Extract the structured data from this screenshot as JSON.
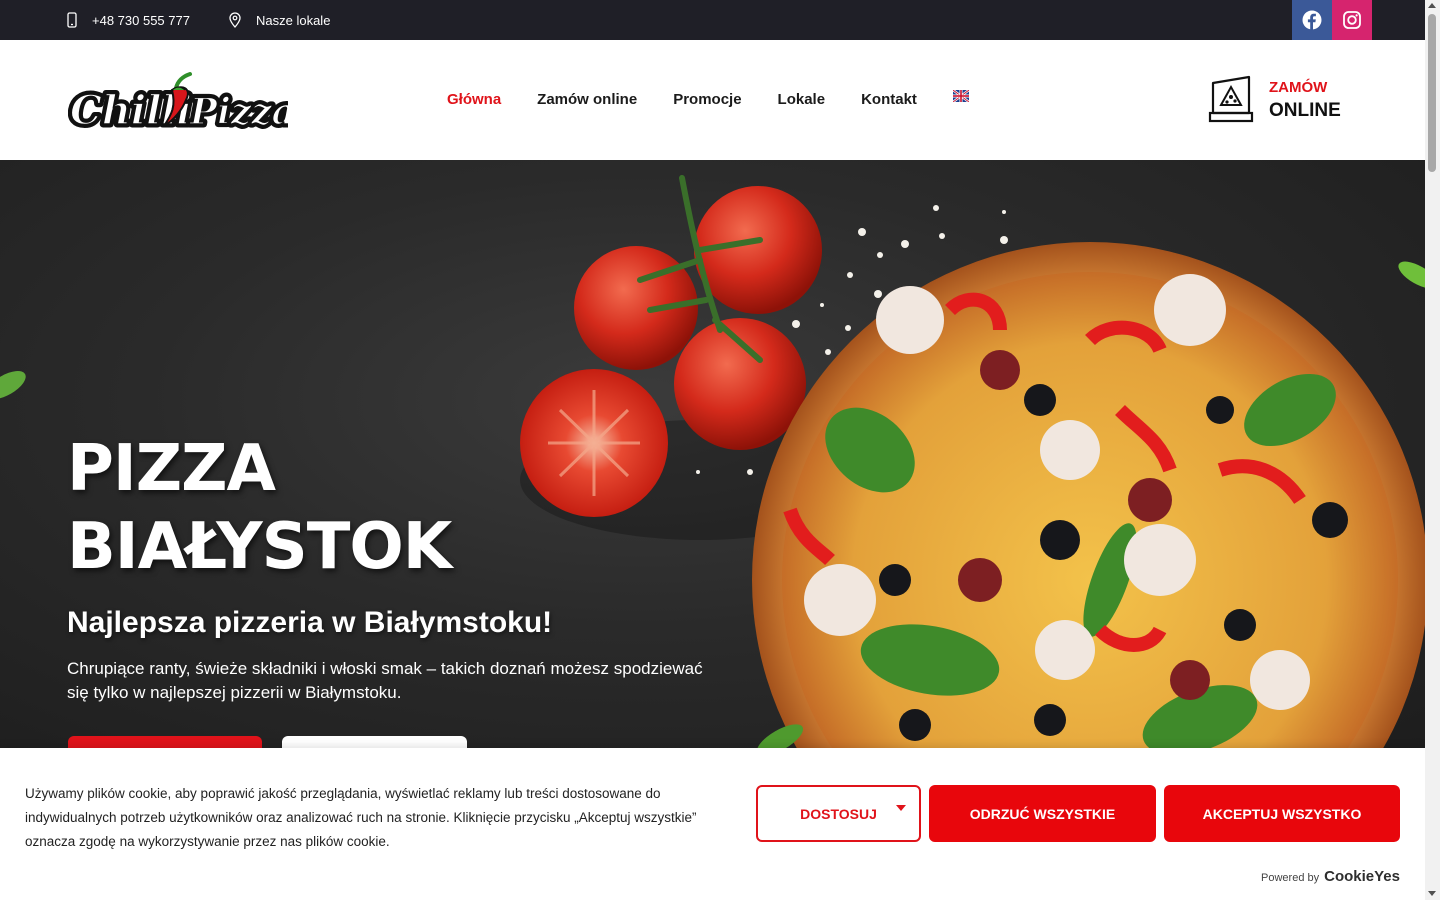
{
  "topbar": {
    "phone": "+48 730 555 777",
    "places": "Nasze lokale",
    "phone_icon": "phone-icon",
    "places_icon": "map-pin-icon",
    "social": [
      {
        "name": "facebook-icon",
        "color": "#3b5998"
      },
      {
        "name": "instagram-icon",
        "color": "#d6246e"
      }
    ]
  },
  "header": {
    "logo_text": "Chilli Pizza",
    "nav": [
      "Główna",
      "Zamów online",
      "Promocje",
      "Lokale",
      "Kontakt"
    ],
    "active_nav": "Główna",
    "language_icon": "uk-flag-icon",
    "order_cta": {
      "line1": "ZAMÓW",
      "line2": "ONLINE",
      "icon": "pizza-box-icon"
    }
  },
  "hero": {
    "title_line1": "PIZZA",
    "title_line2": "BIAŁYSTOK",
    "subtitle": "Najlepsza pizzeria w Białymstoku!",
    "description": "Chrupiące ranty, świeże składniki i włoski smak – takich doznań możesz spodziewać się tylko w najlepszej pizzerii w Białymstoku."
  },
  "cookie": {
    "text": "Używamy plików cookie, aby poprawić jakość przeglądania, wyświetlać reklamy lub treści dostosowane do indywidualnych potrzeb użytkowników oraz analizować ruch na stronie. Kliknięcie przycisku „Akceptuj wszystkie” oznacza zgodę na wykorzystywanie przez nas plików cookie.",
    "customize": "DOSTOSUJ",
    "reject": "ODRZUĆ WSZYSTKIE",
    "accept": "AKCEPTUJ WSZYSTKO",
    "powered_by": "Powered by",
    "brand": "CookieYes"
  },
  "colors": {
    "accent": "#e0131a",
    "topbar": "#1f1f27",
    "hero_bg": "#2a2a2a"
  }
}
